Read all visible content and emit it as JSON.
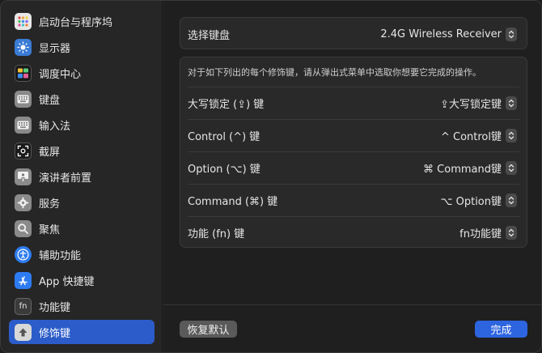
{
  "sidebar": {
    "items": [
      {
        "label": "启动台与程序坞",
        "icon": "launchpad-icon",
        "color": "#e8e8e8"
      },
      {
        "label": "显示器",
        "icon": "sun-icon",
        "color": "#3a7bd5"
      },
      {
        "label": "调度中心",
        "icon": "mission-control-icon",
        "color": "#202020"
      },
      {
        "label": "键盘",
        "icon": "keyboard-icon",
        "color": "#8a8a8a"
      },
      {
        "label": "输入法",
        "icon": "keyboard-icon",
        "color": "#8a8a8a"
      },
      {
        "label": "截屏",
        "icon": "screenshot-icon",
        "color": "#202020"
      },
      {
        "label": "演讲者前置",
        "icon": "presenter-icon",
        "color": "#8a8a8a"
      },
      {
        "label": "服务",
        "icon": "gear-icon",
        "color": "#8a8a8a"
      },
      {
        "label": "聚焦",
        "icon": "magnifier-icon",
        "color": "#8a8a8a"
      },
      {
        "label": "辅助功能",
        "icon": "accessibility-icon",
        "color": "#2d7bf0"
      },
      {
        "label": "App 快捷键",
        "icon": "app-store-icon",
        "color": "#2d7bf0"
      },
      {
        "label": "功能键",
        "icon": "fn-icon",
        "color": "#3a3a3a"
      },
      {
        "label": "修饰键",
        "icon": "up-arrow-icon",
        "color": "#8a8a8a",
        "selected": true
      }
    ]
  },
  "device": {
    "label": "选择键盘",
    "value": "2.4G Wireless Receiver"
  },
  "description": "对于如下列出的每个修饰键，请从弹出式菜单中选取你想要它完成的操作。",
  "modifiers": [
    {
      "label": "大写锁定 (⇪) 键",
      "value": "⇪大写锁定键"
    },
    {
      "label": "Control (^) 键",
      "value": "^ Control键"
    },
    {
      "label": "Option (⌥) 键",
      "value": "⌘ Command键"
    },
    {
      "label": "Command (⌘) 键",
      "value": "⌥ Option键"
    },
    {
      "label": "功能 (fn) 键",
      "value": "fn功能键"
    }
  ],
  "footer": {
    "restore_label": "恢复默认",
    "done_label": "完成"
  },
  "colors": {
    "accent": "#2b5cc9",
    "done_button": "#2d64e0"
  }
}
